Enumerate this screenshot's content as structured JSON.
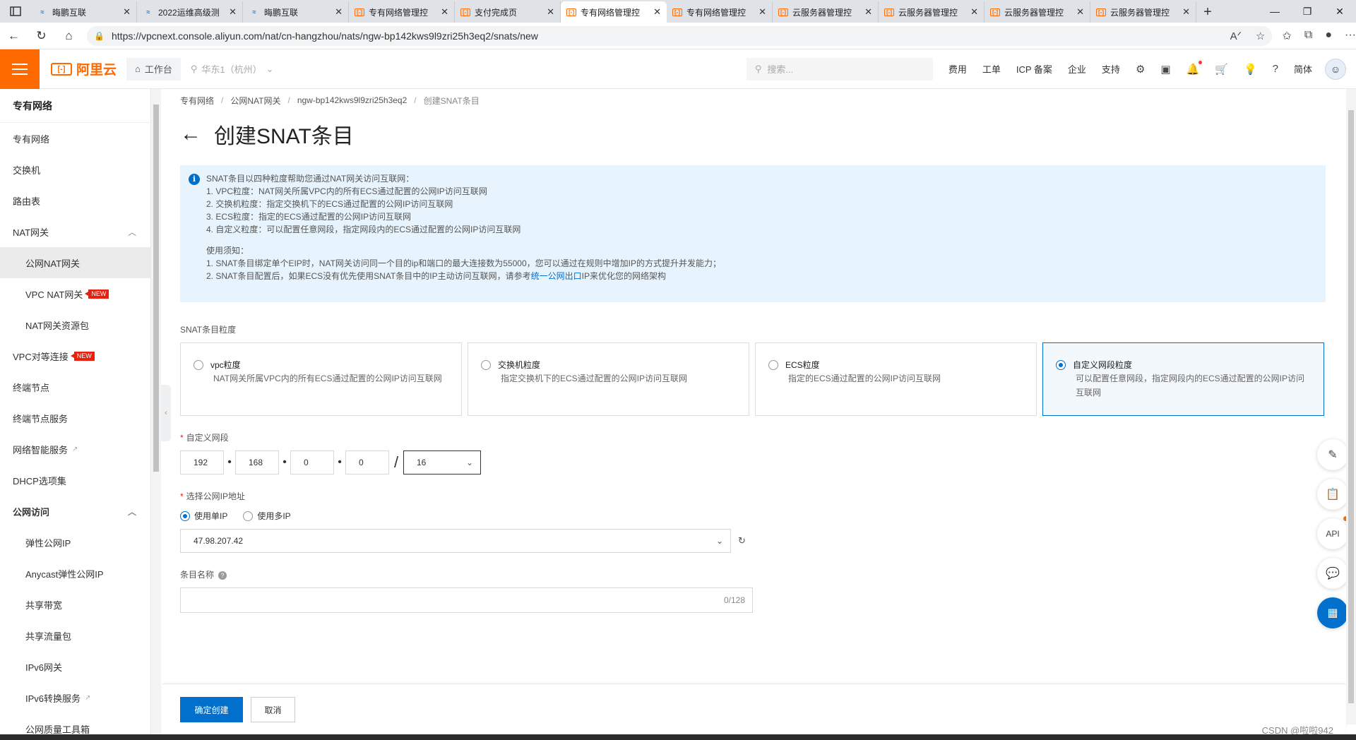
{
  "browser": {
    "tabs": [
      {
        "icon": "vm",
        "title": "晦鹏互联"
      },
      {
        "icon": "vm",
        "title": "2022运维高级测"
      },
      {
        "icon": "vm",
        "title": "晦鹏互联"
      },
      {
        "icon": "ali",
        "title": "专有网络管理控"
      },
      {
        "icon": "ali",
        "title": "支付完成页"
      },
      {
        "icon": "ali",
        "title": "专有网络管理控",
        "active": true
      },
      {
        "icon": "ali",
        "title": "专有网络管理控"
      },
      {
        "icon": "ali",
        "title": "云服务器管理控"
      },
      {
        "icon": "ali",
        "title": "云服务器管理控"
      },
      {
        "icon": "ali",
        "title": "云服务器管理控"
      },
      {
        "icon": "ali",
        "title": "云服务器管理控"
      }
    ],
    "url": "https://vpcnext.console.aliyun.com/nat/cn-hangzhou/nats/ngw-bp142kws9l9zri25h3eq2/snats/new"
  },
  "header": {
    "logo_text": "阿里云",
    "workbench": "工作台",
    "region": "华东1（杭州）",
    "search_placeholder": "搜索...",
    "nav": [
      "费用",
      "工单",
      "ICP 备案",
      "企业",
      "支持"
    ],
    "lang": "简体"
  },
  "sidebar": {
    "title": "专有网络",
    "items": [
      {
        "label": "专有网络",
        "level": 1
      },
      {
        "label": "交换机",
        "level": 1
      },
      {
        "label": "路由表",
        "level": 1
      },
      {
        "label": "NAT网关",
        "level": 1,
        "expanded": true
      },
      {
        "label": "公网NAT网关",
        "level": 2,
        "active": true
      },
      {
        "label": "VPC NAT网关",
        "level": 2,
        "badge": "NEW"
      },
      {
        "label": "NAT网关资源包",
        "level": 2
      },
      {
        "label": "VPC对等连接",
        "level": 1,
        "badge": "NEW"
      },
      {
        "label": "终端节点",
        "level": 1
      },
      {
        "label": "终端节点服务",
        "level": 1
      },
      {
        "label": "网络智能服务",
        "level": 1,
        "external": true
      },
      {
        "label": "DHCP选项集",
        "level": 1
      },
      {
        "label": "公网访问",
        "level": 1,
        "group": true,
        "expanded": true
      },
      {
        "label": "弹性公网IP",
        "level": 2
      },
      {
        "label": "Anycast弹性公网IP",
        "level": 2
      },
      {
        "label": "共享带宽",
        "level": 2
      },
      {
        "label": "共享流量包",
        "level": 2
      },
      {
        "label": "IPv6网关",
        "level": 2
      },
      {
        "label": "IPv6转换服务",
        "level": 2,
        "external": true
      },
      {
        "label": "公网质量工具箱",
        "level": 2
      }
    ]
  },
  "breadcrumb": [
    "专有网络",
    "公网NAT网关",
    "ngw-bp142kws9l9zri25h3eq2",
    "创建SNAT条目"
  ],
  "page_title": "创建SNAT条目",
  "info": {
    "intro": "SNAT条目以四种粒度帮助您通过NAT网关访问互联网：",
    "items": [
      "1. VPC粒度：NAT网关所属VPC内的所有ECS通过配置的公网IP访问互联网",
      "2. 交换机粒度：指定交换机下的ECS通过配置的公网IP访问互联网",
      "3. ECS粒度：指定的ECS通过配置的公网IP访问互联网",
      "4. 自定义粒度：可以配置任意网段，指定网段内的ECS通过配置的公网IP访问互联网"
    ],
    "notice_title": "使用须知：",
    "notice_1": "1. SNAT条目绑定单个EIP时，NAT网关访问同一个目的ip和端口的最大连接数为55000，您可以通过在规则中增加IP的方式提升并发能力；",
    "notice_2_before": "2. SNAT条目配置后，如果ECS没有优先使用SNAT条目中的IP主动访问互联网，请参考",
    "notice_2_link": "统一公网出口",
    "notice_2_after": "IP来优化您的网络架构"
  },
  "form": {
    "granularity_label": "SNAT条目粒度",
    "granularity_options": [
      {
        "title": "vpc粒度",
        "desc": "NAT网关所属VPC内的所有ECS通过配置的公网IP访问互联网",
        "selected": false
      },
      {
        "title": "交换机粒度",
        "desc": "指定交换机下的ECS通过配置的公网IP访问互联网",
        "selected": false
      },
      {
        "title": "ECS粒度",
        "desc": "指定的ECS通过配置的公网IP访问互联网",
        "selected": false
      },
      {
        "title": "自定义网段粒度",
        "desc": "可以配置任意网段，指定网段内的ECS通过配置的公网IP访问互联网",
        "selected": true
      }
    ],
    "cidr_label": "自定义网段",
    "cidr": [
      "192",
      "168",
      "0",
      "0"
    ],
    "mask": "16",
    "eip_label": "选择公网IP地址",
    "eip_mode_single": "使用单IP",
    "eip_mode_multi": "使用多IP",
    "eip_value": "47.98.207.42",
    "name_label": "条目名称",
    "name_value": "",
    "name_count": "0/128"
  },
  "actions": {
    "confirm": "确定创建",
    "cancel": "取消"
  },
  "float_tools": {
    "api_label": "API"
  },
  "watermark": "CSDN @啦啦942",
  "colors": {
    "brand": "#ff6a00",
    "primary": "#0070cc",
    "info_bg": "#e8f4fd",
    "new_badge": "#e8200e"
  }
}
